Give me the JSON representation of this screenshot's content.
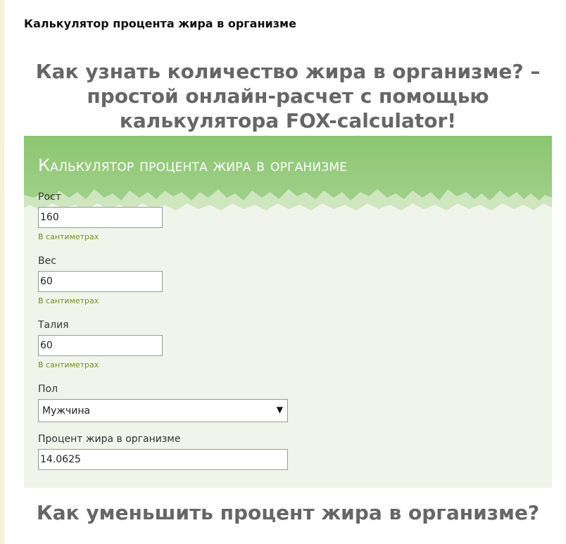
{
  "page": {
    "title": "Калькулятор процента жира в организме",
    "heading": "Как узнать количество жира в организме? – простой онлайн-расчет с помощью калькулятора FOX-calculator!"
  },
  "calculator": {
    "title": "Калькулятор процента жира в организме",
    "fields": [
      {
        "label": "Рост",
        "value": "160",
        "hint": "В сантиметрах"
      },
      {
        "label": "Вес",
        "value": "60",
        "hint": "В сантиметрах"
      },
      {
        "label": "Талия",
        "value": "60",
        "hint": "В сантиметрах"
      }
    ],
    "gender": {
      "label": "Пол",
      "selected": "Мужчина"
    },
    "result": {
      "label": "Процент жира в организме",
      "value": "14.0625"
    }
  },
  "section2": {
    "heading": "Как уменьшить процент жира в организме?"
  },
  "colors": {
    "banner_green": "#8cc66f",
    "panel_bg": "#f1f4ea",
    "hint_color": "#7a8c1f"
  }
}
